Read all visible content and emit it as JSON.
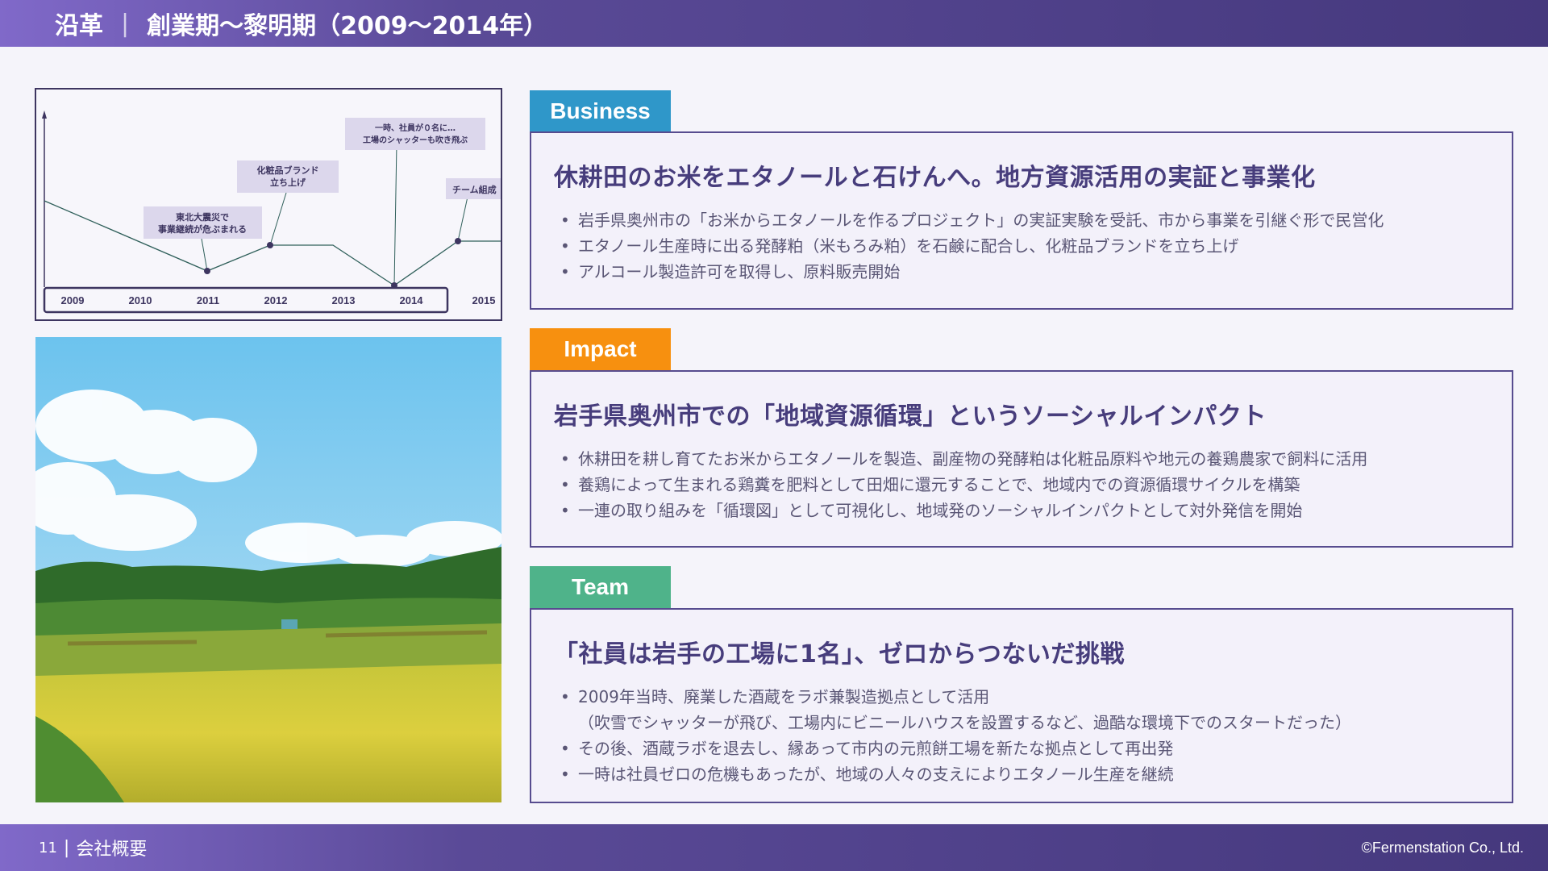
{
  "header": {
    "section": "沿革",
    "separator": "|",
    "title": "創業期～黎明期（2009～2014年）"
  },
  "timeline": {
    "years": [
      "2009",
      "2010",
      "2011",
      "2012",
      "2013",
      "2014",
      "2015"
    ],
    "events": [
      {
        "label_line1": "東北大震災で",
        "label_line2": "事業継続が危ぶまれる"
      },
      {
        "label_line1": "化粧品ブランド",
        "label_line2": "立ち上げ"
      },
      {
        "label_line1": "一時、社員が０名に…",
        "label_line2": "工場のシャッターも吹き飛ぶ"
      },
      {
        "label_line1": "チーム組成",
        "label_line2": ""
      }
    ]
  },
  "sections": {
    "business": {
      "tag": "Business",
      "heading": "休耕田のお米をエタノールと石けんへ。地方資源活用の実証と事業化",
      "bullets": [
        "岩手県奥州市の「お米からエタノールを作るプロジェクト」の実証実験を受託、市から事業を引継ぐ形で民営化",
        "エタノール生産時に出る発酵粕（米もろみ粕）を石鹸に配合し、化粧品ブランドを立ち上げ",
        "アルコール製造許可を取得し、原料販売開始"
      ]
    },
    "impact": {
      "tag": "Impact",
      "heading": "岩手県奥州市での「地域資源循環」というソーシャルインパクト",
      "bullets": [
        "休耕田を耕し育てたお米からエタノールを製造、副産物の発酵粕は化粧品原料や地元の養鶏農家で飼料に活用",
        "養鶏によって生まれる鶏糞を肥料として田畑に還元することで、地域内での資源循環サイクルを構築",
        "一連の取り組みを「循環図」として可視化し、地域発のソーシャルインパクトとして対外発信を開始"
      ]
    },
    "team": {
      "tag": "Team",
      "heading": "「社員は岩手の工場に1名」、ゼロからつないだ挑戦",
      "bullet1_line1": "2009年当時、廃業した酒蔵をラボ兼製造拠点として活用",
      "bullet1_line2": "（吹雪でシャッターが飛び、工場内にビニールハウスを設置するなど、過酷な環境下でのスタートだった）",
      "bullet2": "その後、酒蔵ラボを退去し、縁あって市内の元煎餅工場を新たな拠点として再出発",
      "bullet3": "一時は社員ゼロの危機もあったが、地域の人々の支えによりエタノール生産を継続"
    }
  },
  "footer": {
    "page_number": "11",
    "separator": "|",
    "section_name": "会社概要",
    "copyright": "©Fermenstation Co., Ltd."
  },
  "colors": {
    "header_start": "#8069c9",
    "header_end": "#45387d",
    "business": "#2f97c9",
    "impact": "#f7900f",
    "team": "#4fb38a",
    "heading": "#473d7c"
  }
}
